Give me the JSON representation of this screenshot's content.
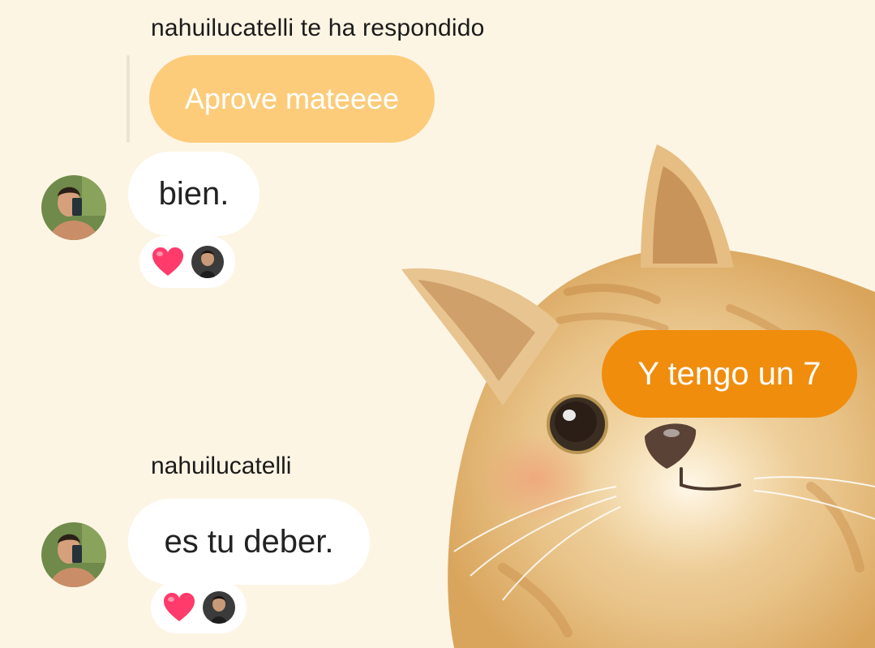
{
  "reply_label": "nahuilucatelli te ha respondido",
  "quoted_message": {
    "text": "Aprove mateeee"
  },
  "messages": [
    {
      "id": "m1",
      "direction": "incoming",
      "text": "bien.",
      "reactions": [
        "heart-emoji",
        "reactor-avatar"
      ]
    },
    {
      "id": "m2",
      "direction": "outgoing",
      "text": "Y tengo un 7"
    },
    {
      "id": "m3",
      "direction": "incoming",
      "sender": "nahuilucatelli",
      "text": "es tu deber.",
      "reactions": [
        "heart-emoji",
        "reactor-avatar"
      ]
    }
  ],
  "colors": {
    "background": "#fdf5e4",
    "quoted_bubble": "#fccc7b",
    "outgoing_bubble": "#f08d0d",
    "incoming_bubble": "#ffffff",
    "heart": "#ff3b6b"
  },
  "wallpaper": "cat-illustration"
}
